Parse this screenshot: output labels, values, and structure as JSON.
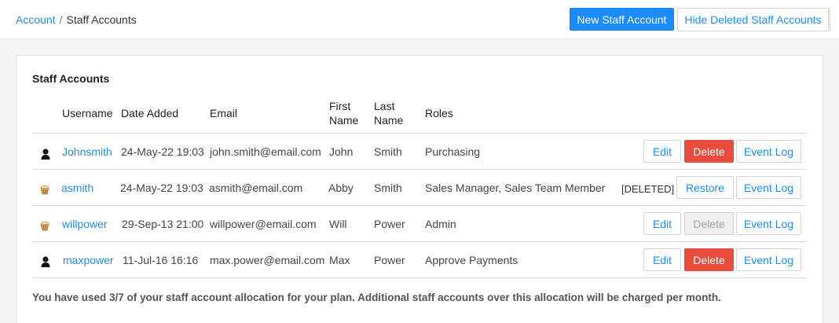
{
  "breadcrumb": {
    "parent": "Account",
    "separator": "/",
    "current": "Staff Accounts"
  },
  "top_actions": {
    "new_label": "New Staff Account",
    "hide_deleted_label": "Hide Deleted Staff Accounts"
  },
  "panel": {
    "title": "Staff Accounts"
  },
  "table": {
    "headers": {
      "username": "Username",
      "date_added": "Date Added",
      "email": "Email",
      "first_name_1": "First",
      "first_name_2": "Name",
      "last_name_1": "Last",
      "last_name_2": "Name",
      "roles": "Roles"
    },
    "rows": [
      {
        "avatar": "person-silhouette",
        "username": "Johnsmith",
        "date_added": "24-May-22 19:03",
        "email": "john.smith@email.com",
        "first_name": "John",
        "last_name": "Smith",
        "roles": "Purchasing",
        "edit": "Edit",
        "delete": "Delete",
        "event_log": "Event Log"
      },
      {
        "avatar": "cupcake",
        "username": "asmith",
        "date_added": "24-May-22 19:03",
        "email": "asmith@email.com",
        "first_name": "Abby",
        "last_name": "Smith",
        "roles": "Sales Manager, Sales Team Member",
        "status": "[DELETED]",
        "restore": "Restore",
        "event_log": "Event Log"
      },
      {
        "avatar": "cupcake",
        "username": "willpower",
        "date_added": "29-Sep-13 21:00",
        "email": "willpower@email.com",
        "first_name": "Will",
        "last_name": "Power",
        "roles": "Admin",
        "edit": "Edit",
        "delete": "Delete",
        "event_log": "Event Log"
      },
      {
        "avatar": "person-silhouette",
        "username": "maxpower",
        "date_added": "11-Jul-16 16:16",
        "email": "max.power@email.com",
        "first_name": "Max",
        "last_name": "Power",
        "roles": "Approve Payments",
        "edit": "Edit",
        "delete": "Delete",
        "event_log": "Event Log"
      }
    ]
  },
  "footnote": "You have used 3/7 of your staff account allocation for your plan. Additional staff accounts over this allocation will be charged per month.",
  "colors": {
    "accent": "#1a8cff",
    "danger": "#e74c3c",
    "disabled": "#efefef"
  }
}
